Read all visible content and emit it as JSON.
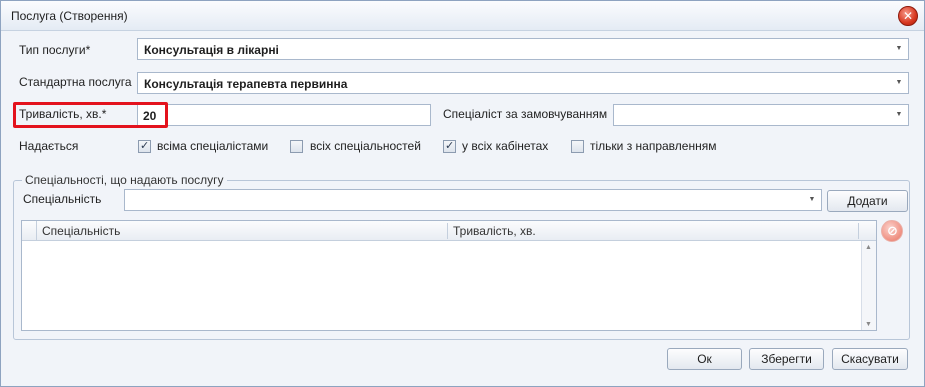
{
  "window": {
    "title": "Послуга (Створення)"
  },
  "form": {
    "service_type": {
      "label": "Тип послуги*",
      "value": "Консультація в лікарні"
    },
    "standard_service": {
      "label": "Стандартна послуга",
      "value": "Консультація терапевта первинна"
    },
    "duration": {
      "label": "Тривалість, хв.*",
      "value": "20"
    },
    "default_specialist": {
      "label": "Спеціаліст за замовчуванням",
      "value": ""
    },
    "provided_label": "Надається",
    "checkboxes": [
      {
        "label": "всіма спеціалістами",
        "checked": true
      },
      {
        "label": "всіх спеціальностей",
        "checked": false
      },
      {
        "label": "у всіх кабінетах",
        "checked": true
      },
      {
        "label": "тільки з направленням",
        "checked": false
      }
    ]
  },
  "specialties_group": {
    "legend": "Спеціальності, що надають послугу",
    "specialty_label": "Спеціальність",
    "specialty_value": "",
    "add_button": "Додати",
    "columns": [
      "Спеціальність",
      "Тривалість, хв."
    ],
    "rows": []
  },
  "footer": {
    "ok": "Ок",
    "save": "Зберегти",
    "cancel": "Скасувати"
  },
  "icons": {
    "close": "close-icon",
    "delete": "delete-row-icon",
    "dropdown": "chevron-down-icon"
  },
  "colors": {
    "highlight": "#e3121d",
    "window_bg": "#f1f4f9"
  }
}
